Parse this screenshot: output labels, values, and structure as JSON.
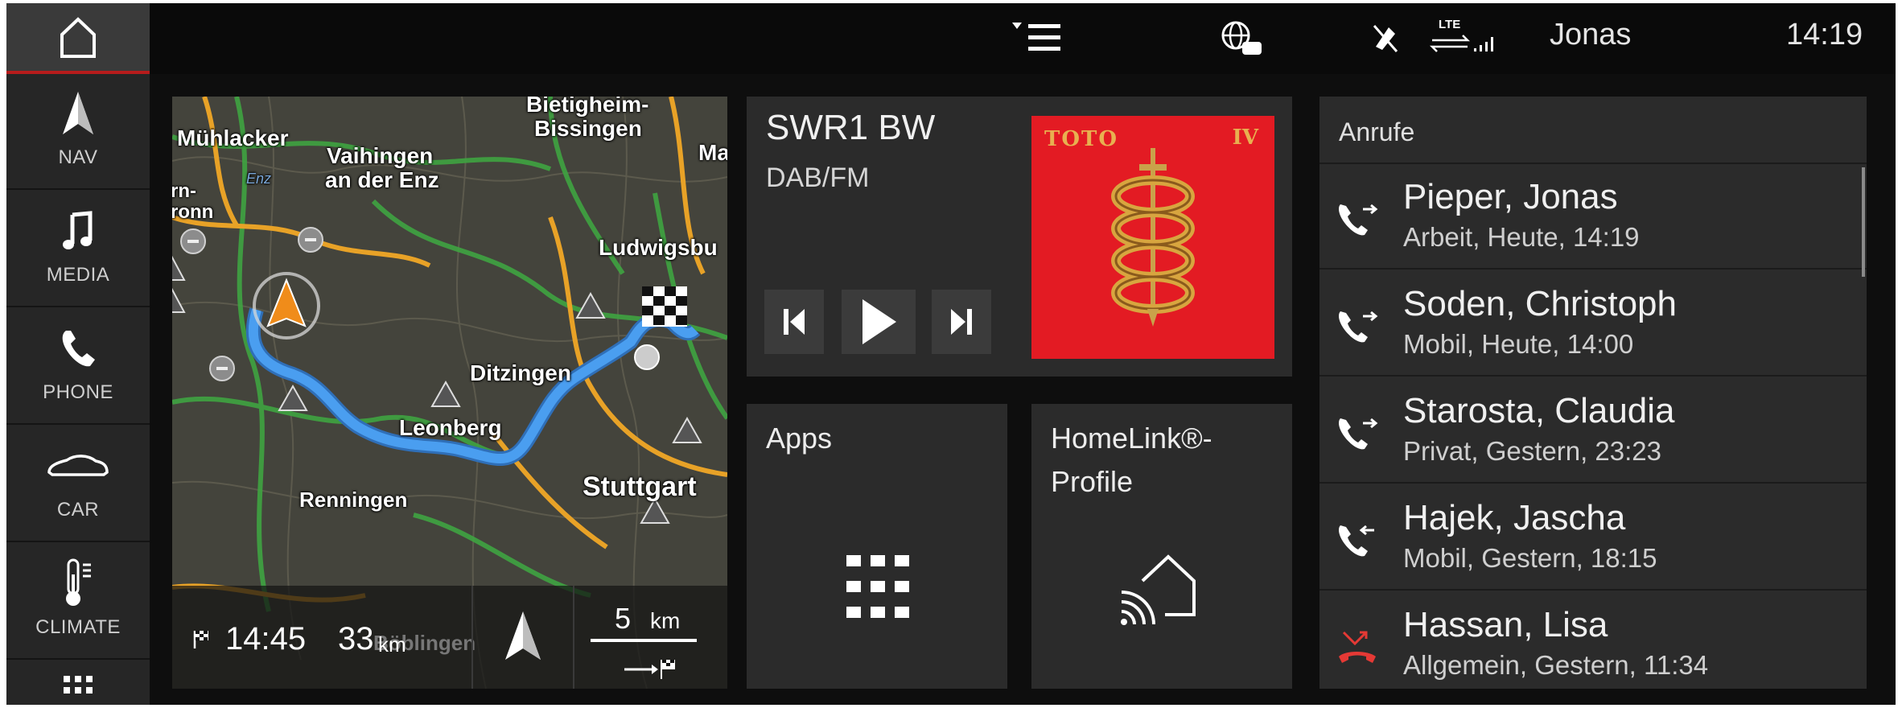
{
  "sidebar": {
    "items": [
      {
        "label": "NAV",
        "icon": "navigation-arrow-icon"
      },
      {
        "label": "MEDIA",
        "icon": "music-note-icon"
      },
      {
        "label": "PHONE",
        "icon": "phone-handset-icon"
      },
      {
        "label": "CAR",
        "icon": "car-icon"
      },
      {
        "label": "CLIMATE",
        "icon": "thermometer-icon"
      }
    ]
  },
  "status": {
    "lte": "LTE",
    "user": "Jonas",
    "time": "14:19"
  },
  "map": {
    "labels": {
      "bietigheim": "Bietigheim-",
      "bissingen": "Bissingen",
      "muhlacker": "Mühlacker",
      "vaihingen1": "Vaihingen",
      "vaihingen2": "an der Enz",
      "enz": "Enz",
      "rn": "rn-",
      "ronn": "ronn",
      "ludwigsbu": "Ludwigsbu",
      "ditzingen": "Ditzingen",
      "leonberg": "Leonberg",
      "renningen": "Renningen",
      "stuttgart": "Stuttgart",
      "boblingen": "Böblingen",
      "ma": "Ma"
    },
    "eta": "14:45",
    "distance_value": "33",
    "distance_unit": "km",
    "scale_value": "5",
    "scale_unit": "km"
  },
  "media": {
    "station": "SWR1 BW",
    "source": "DAB/FM",
    "album_band": "TOTO",
    "album_title": "IV"
  },
  "apps": {
    "title": "Apps"
  },
  "homelink": {
    "title_line1": "HomeLink®-",
    "title_line2": "Profile"
  },
  "calls": {
    "title": "Anrufe",
    "items": [
      {
        "name": "Pieper, Jonas",
        "detail": "Arbeit, Heute, 14:19",
        "type": "outgoing"
      },
      {
        "name": "Soden, Christoph",
        "detail": "Mobil, Heute, 14:00",
        "type": "outgoing"
      },
      {
        "name": "Starosta, Claudia",
        "detail": "Privat, Gestern, 23:23",
        "type": "outgoing"
      },
      {
        "name": "Hajek, Jascha",
        "detail": "Mobil, Gestern, 18:15",
        "type": "incoming"
      },
      {
        "name": "Hassan, Lisa",
        "detail": "Allgemein, Gestern, 11:34",
        "type": "missed"
      }
    ]
  },
  "colors": {
    "accent_red": "#b71c1c",
    "route_blue": "#3d8fe6",
    "missed_red": "#e53935"
  }
}
